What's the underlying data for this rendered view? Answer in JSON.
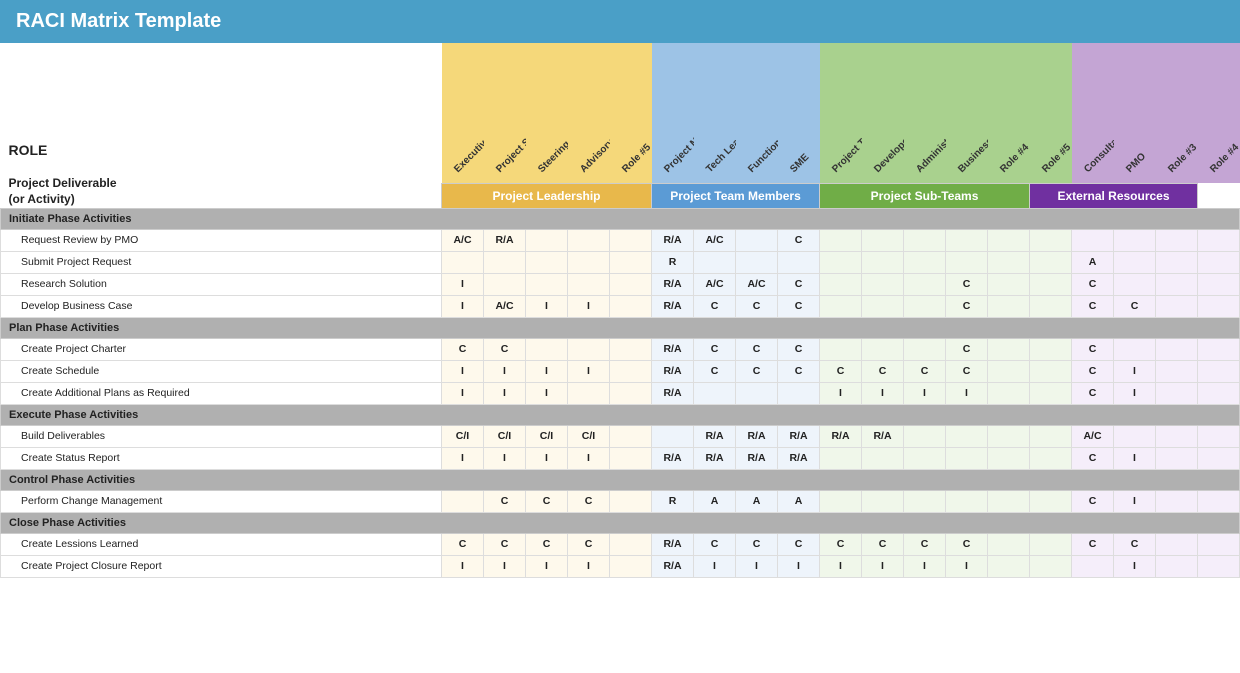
{
  "title": "RACI Matrix Template",
  "role_label": "ROLE",
  "deliverable_label": "Project Deliverable\n(or Activity)",
  "groups": [
    {
      "label": "Project Leadership",
      "color": "yellow",
      "cols": 5
    },
    {
      "label": "Project Team Members",
      "color": "blue",
      "cols": 4
    },
    {
      "label": "Project Sub-Teams",
      "color": "green",
      "cols": 5
    },
    {
      "label": "External Resources",
      "color": "purple",
      "cols": 4
    }
  ],
  "columns": [
    {
      "label": "Executive Sponsor",
      "zone": "yellow"
    },
    {
      "label": "Project Sponsor",
      "zone": "yellow"
    },
    {
      "label": "Steering Committee",
      "zone": "yellow"
    },
    {
      "label": "Advisory Committee",
      "zone": "yellow"
    },
    {
      "label": "Role #5",
      "zone": "yellow"
    },
    {
      "label": "Project Manager",
      "zone": "blue"
    },
    {
      "label": "Tech Lead",
      "zone": "blue"
    },
    {
      "label": "Functional Lead",
      "zone": "blue"
    },
    {
      "label": "SME",
      "zone": "blue"
    },
    {
      "label": "Project Team Member",
      "zone": "green"
    },
    {
      "label": "Developer",
      "zone": "green"
    },
    {
      "label": "Administrative Support",
      "zone": "green"
    },
    {
      "label": "Business Analyst",
      "zone": "green"
    },
    {
      "label": "Role #4",
      "zone": "green"
    },
    {
      "label": "Role #5",
      "zone": "green"
    },
    {
      "label": "Consultant",
      "zone": "purple"
    },
    {
      "label": "PMO",
      "zone": "purple"
    },
    {
      "label": "Role #3",
      "zone": "purple"
    },
    {
      "label": "Role #4",
      "zone": "purple"
    }
  ],
  "sections": [
    {
      "label": "Initiate Phase Activities",
      "rows": [
        {
          "label": "Request Review by PMO",
          "cells": [
            "A/C",
            "R/A",
            "",
            "",
            "",
            "R/A",
            "A/C",
            "",
            "C",
            "",
            "",
            "",
            "",
            "",
            "",
            "",
            "",
            "",
            ""
          ]
        },
        {
          "label": "Submit Project Request",
          "cells": [
            "",
            "",
            "",
            "",
            "",
            "R",
            "",
            "",
            "",
            "",
            "",
            "",
            "",
            "",
            "",
            "A",
            "",
            "",
            ""
          ]
        },
        {
          "label": "Research Solution",
          "cells": [
            "I",
            "",
            "",
            "",
            "",
            "R/A",
            "A/C",
            "A/C",
            "C",
            "",
            "",
            "",
            "C",
            "",
            "",
            "C",
            "",
            "",
            ""
          ]
        },
        {
          "label": "Develop Business Case",
          "cells": [
            "I",
            "A/C",
            "I",
            "I",
            "",
            "R/A",
            "C",
            "C",
            "C",
            "",
            "",
            "",
            "C",
            "",
            "",
            "C",
            "C",
            "",
            ""
          ]
        }
      ]
    },
    {
      "label": "Plan Phase Activities",
      "rows": [
        {
          "label": "Create Project Charter",
          "cells": [
            "C",
            "C",
            "",
            "",
            "",
            "R/A",
            "C",
            "C",
            "C",
            "",
            "",
            "",
            "C",
            "",
            "",
            "C",
            "",
            "",
            ""
          ]
        },
        {
          "label": "Create Schedule",
          "cells": [
            "I",
            "I",
            "I",
            "I",
            "",
            "R/A",
            "C",
            "C",
            "C",
            "C",
            "C",
            "C",
            "C",
            "",
            "",
            "C",
            "I",
            "",
            ""
          ]
        },
        {
          "label": "Create Additional Plans as Required",
          "cells": [
            "I",
            "I",
            "I",
            "",
            "",
            "R/A",
            "",
            "",
            "",
            "I",
            "I",
            "I",
            "I",
            "",
            "",
            "C",
            "I",
            ""
          ]
        }
      ]
    },
    {
      "label": "Execute Phase Activities",
      "rows": [
        {
          "label": "Build Deliverables",
          "cells": [
            "C/I",
            "C/I",
            "C/I",
            "C/I",
            "",
            "",
            "R/A",
            "R/A",
            "R/A",
            "R/A",
            "R/A",
            "",
            "",
            "",
            "",
            "A/C",
            "",
            "",
            ""
          ]
        },
        {
          "label": "Create Status Report",
          "cells": [
            "I",
            "I",
            "I",
            "I",
            "",
            "R/A",
            "R/A",
            "R/A",
            "R/A",
            "",
            "",
            "",
            "",
            "",
            "",
            "C",
            "I",
            ""
          ]
        }
      ]
    },
    {
      "label": "Control Phase Activities",
      "rows": [
        {
          "label": "Perform Change Management",
          "cells": [
            "",
            "C",
            "C",
            "C",
            "",
            "R",
            "A",
            "A",
            "A",
            "",
            "",
            "",
            "",
            "",
            "",
            "C",
            "I",
            ""
          ]
        }
      ]
    },
    {
      "label": "Close Phase Activities",
      "rows": [
        {
          "label": "Create Lessions Learned",
          "cells": [
            "C",
            "C",
            "C",
            "C",
            "",
            "R/A",
            "C",
            "C",
            "C",
            "C",
            "C",
            "C",
            "C",
            "",
            "",
            "C",
            "C",
            "",
            ""
          ]
        },
        {
          "label": "Create Project Closure Report",
          "cells": [
            "I",
            "I",
            "I",
            "I",
            "",
            "R/A",
            "I",
            "I",
            "I",
            "I",
            "I",
            "I",
            "I",
            "",
            "",
            "",
            "I",
            ""
          ]
        }
      ]
    }
  ]
}
